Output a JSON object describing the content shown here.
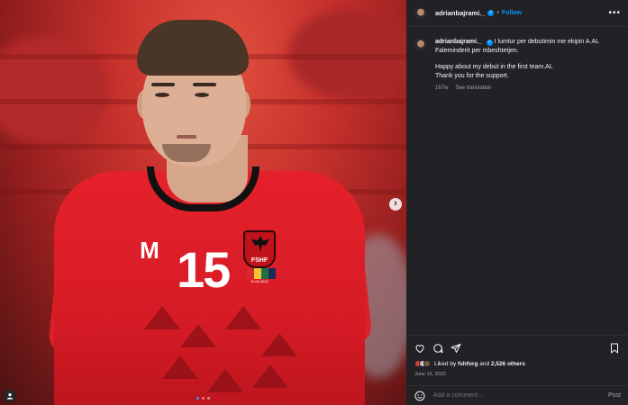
{
  "post": {
    "username": "adrianbajrami._",
    "follow_label": "Follow",
    "separator": "•",
    "more_label": "•••",
    "caption": {
      "line1": "I lumtur per debutimin me ekipin A.AL",
      "line2": "Faleminderit per mbeshtetjen.",
      "line3": "Happy about my debut in the first team.AL",
      "line4": "Thank you for the support."
    },
    "age": "167w",
    "see_translation": "See translation",
    "liked_by_prefix": "Liked by ",
    "liked_by_user": "fshforg",
    "liked_by_and": " and ",
    "likes_count": "2,526 others",
    "date": "June 15, 2022",
    "comment_placeholder": "Add a comment...",
    "post_label": "Post"
  },
  "media": {
    "shirt_number": "15",
    "crest_text": "FSHF",
    "brand_mark": "M",
    "patch_date": "11.06.2022",
    "carousel_dots": 3,
    "active_dot": 0
  },
  "colors": {
    "panel_bg": "#212126",
    "accent": "#0095f6",
    "jersey_red": "#dd1f28"
  },
  "icons": [
    "more-icon",
    "verified-icon",
    "heart-icon",
    "comment-icon",
    "share-icon",
    "bookmark-icon",
    "emoji-icon",
    "next-arrow-icon",
    "tag-user-icon"
  ]
}
